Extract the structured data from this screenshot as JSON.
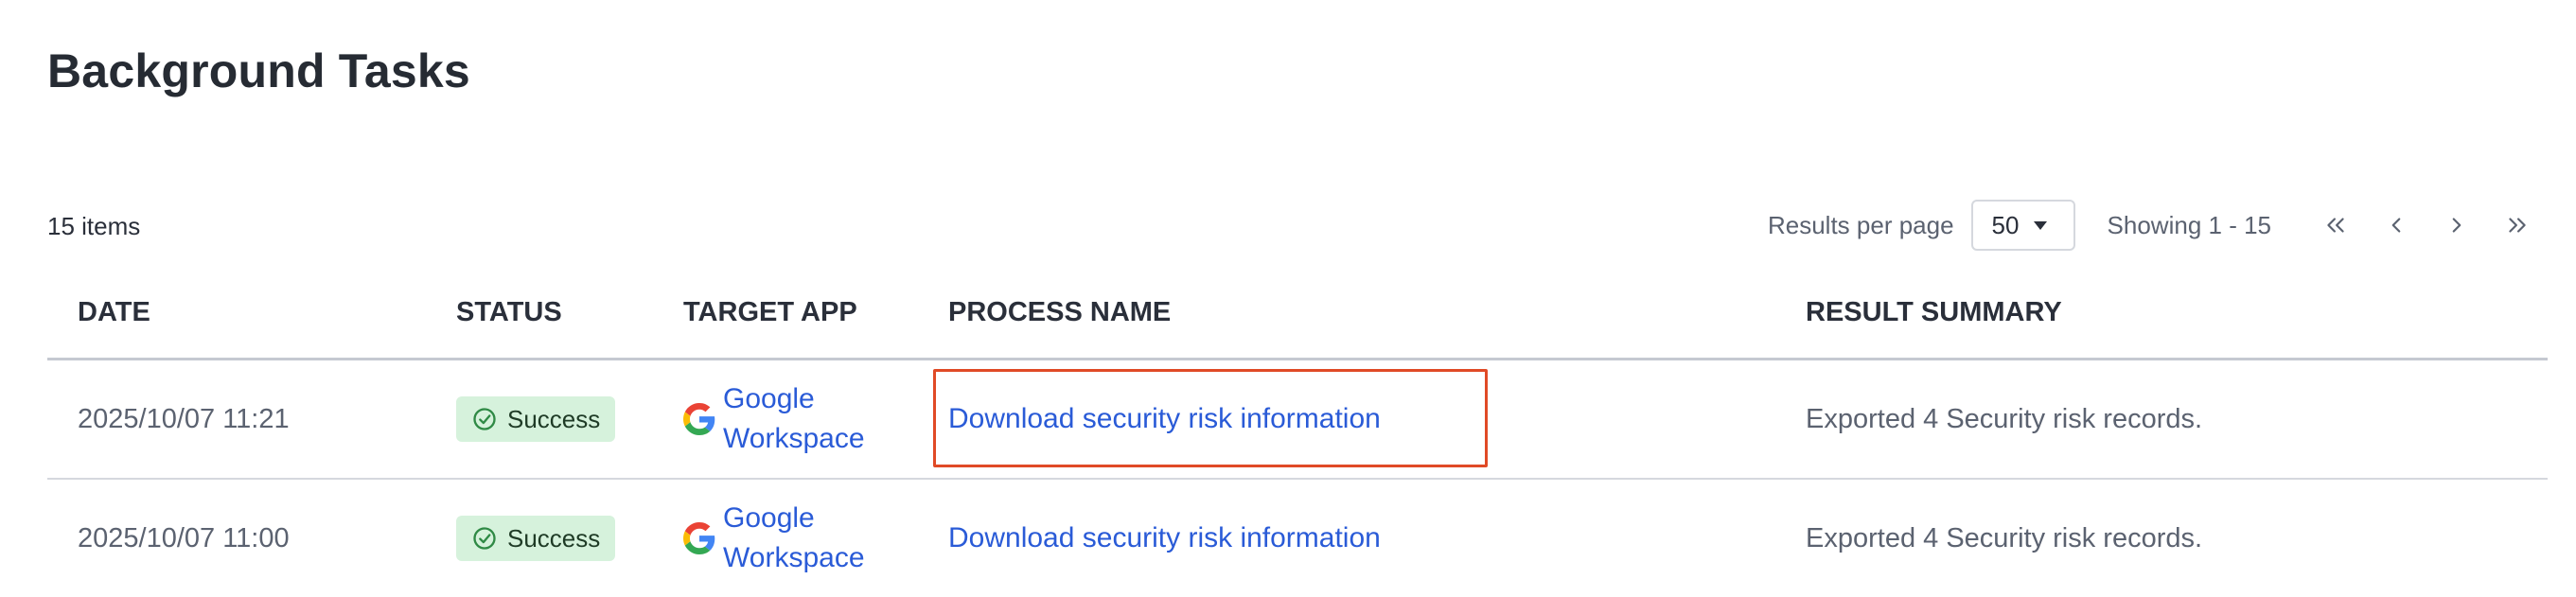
{
  "page": {
    "title": "Background Tasks"
  },
  "toolbar": {
    "items_count": "15 items",
    "results_per_page_label": "Results per page",
    "results_per_page_value": "50",
    "showing_text": "Showing 1 - 15"
  },
  "table": {
    "headers": {
      "date": "DATE",
      "status": "STATUS",
      "target_app": "TARGET APP",
      "process_name": "PROCESS NAME",
      "result_summary": "RESULT SUMMARY"
    },
    "rows": [
      {
        "date": "2025/10/07 11:21",
        "status": "Success",
        "app_line1": "Google",
        "app_line2": "Workspace",
        "process_name": "Download security risk information",
        "result_summary": "Exported 4 Security risk records."
      },
      {
        "date": "2025/10/07 11:00",
        "status": "Success",
        "app_line1": "Google",
        "app_line2": "Workspace",
        "process_name": "Download security risk information",
        "result_summary": "Exported 4 Security risk records."
      }
    ]
  },
  "icons": {
    "status": "check-circle-icon",
    "app": "google-logo-icon",
    "pager": [
      "first-page-icon",
      "previous-page-icon",
      "next-page-icon",
      "last-page-icon"
    ]
  },
  "colors": {
    "link": "#2a5bd7",
    "success_bg": "#d6f2dc",
    "success_icon": "#2f8a45",
    "highlight": "#e04a26"
  }
}
